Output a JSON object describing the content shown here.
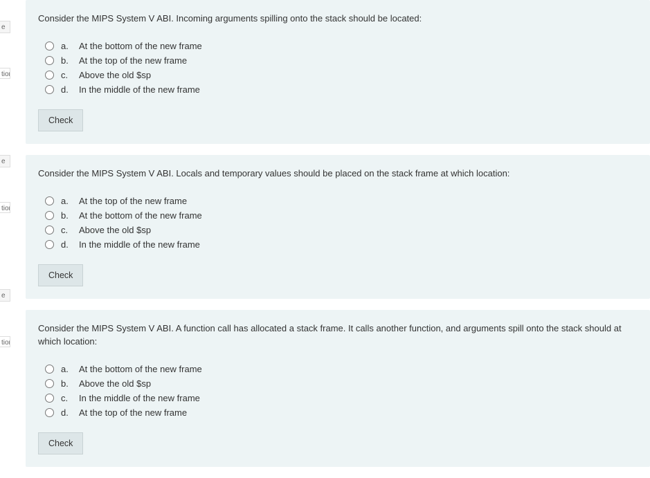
{
  "sidebar": {
    "tab_label": "e",
    "flag_label": "tion"
  },
  "questions": [
    {
      "prompt": "Consider the MIPS System V ABI. Incoming arguments spilling onto the stack should be located:",
      "options": [
        {
          "letter": "a.",
          "text": "At the bottom of the new frame"
        },
        {
          "letter": "b.",
          "text": "At the top of the new frame"
        },
        {
          "letter": "c.",
          "text": "Above the old $sp"
        },
        {
          "letter": "d.",
          "text": "In the middle of the new frame"
        }
      ],
      "check_label": "Check"
    },
    {
      "prompt": "Consider the MIPS System V ABI. Locals and temporary values should be placed on the stack frame at which location:",
      "options": [
        {
          "letter": "a.",
          "text": "At the top of the new frame"
        },
        {
          "letter": "b.",
          "text": "At the bottom of the new frame"
        },
        {
          "letter": "c.",
          "text": "Above the old $sp"
        },
        {
          "letter": "d.",
          "text": "In the middle of the new frame"
        }
      ],
      "check_label": "Check"
    },
    {
      "prompt": "Consider the MIPS System V ABI. A function call has allocated a stack frame. It calls another function, and arguments spill onto the stack should at which location:",
      "options": [
        {
          "letter": "a.",
          "text": "At the bottom of the new frame"
        },
        {
          "letter": "b.",
          "text": "Above the old $sp"
        },
        {
          "letter": "c.",
          "text": "In the middle of the new frame"
        },
        {
          "letter": "d.",
          "text": "At the top of the new frame"
        }
      ],
      "check_label": "Check"
    }
  ]
}
